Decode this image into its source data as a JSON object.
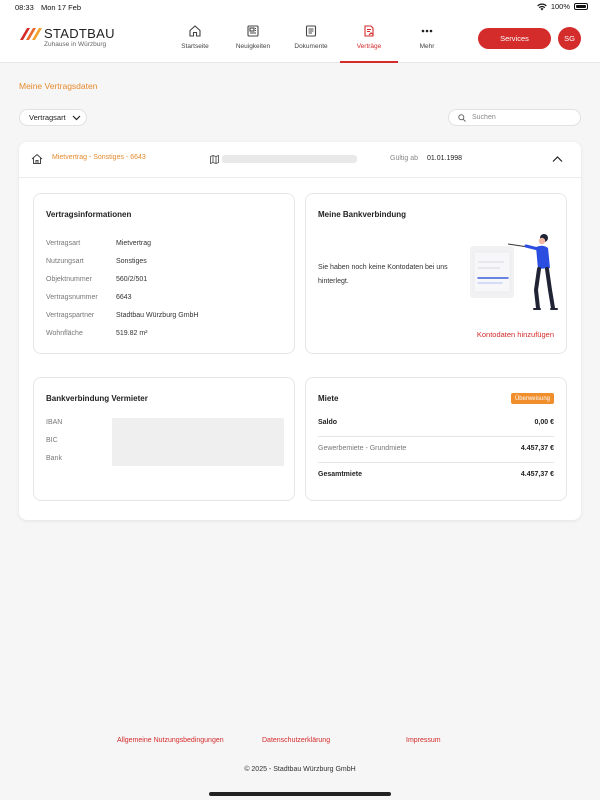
{
  "status_bar": {
    "time": "08:33",
    "date": "Mon 17 Feb",
    "battery": "100%"
  },
  "header": {
    "logo_name": "STADTBAU",
    "logo_tagline": "Zuhause in Würzburg",
    "nav": [
      {
        "label": "Startseite",
        "icon": "home-icon"
      },
      {
        "label": "Neuigkeiten",
        "icon": "news-icon"
      },
      {
        "label": "Dokumente",
        "icon": "document-icon"
      },
      {
        "label": "Verträge",
        "icon": "contract-icon",
        "active": true
      },
      {
        "label": "Mehr",
        "icon": "more-icon"
      }
    ],
    "services_label": "Services",
    "avatar_initials": "SG",
    "accent_color": "#d42b2b"
  },
  "page": {
    "title": "Meine Vertragsdaten",
    "filter_label": "Vertragsart",
    "search_placeholder": "Suchen"
  },
  "contract": {
    "title": "Mietvertrag - Sonstiges - 6643",
    "valid_label": "Gültig ab",
    "valid_date": "01.01.1998",
    "info": {
      "title": "Vertragsinformationen",
      "rows": [
        {
          "label": "Vertragsart",
          "value": "Mietvertrag"
        },
        {
          "label": "Nutzungsart",
          "value": "Sonstiges"
        },
        {
          "label": "Objektnummer",
          "value": "560/2/501"
        },
        {
          "label": "Vertragsnummer",
          "value": "6643"
        },
        {
          "label": "Vertragspartner",
          "value": "Stadtbau Würzburg GmbH"
        },
        {
          "label": "Wohnfläche",
          "value": "519.82 m²"
        }
      ]
    },
    "bank": {
      "title": "Meine Bankverbindung",
      "message": "Sie haben noch keine Kontodaten bei uns hinterlegt.",
      "add_link": "Kontodaten hinzufügen"
    },
    "landlord": {
      "title": "Bankverbindung Vermieter",
      "labels": [
        "IBAN",
        "BIC",
        "Bank"
      ]
    },
    "rent": {
      "title": "Miete",
      "badge": "Überweisung",
      "badge_color": "#ef8e2b",
      "saldo_label": "Saldo",
      "saldo_value": "0,00 €",
      "item_label": "Gewerbemiete - Grundmiete",
      "item_value": "4.457,37 €",
      "total_label": "Gesamtmiete",
      "total_value": "4.457,37 €"
    }
  },
  "footer": {
    "links": [
      "Allgemeine Nutzungsbedingungen",
      "Datenschutzerklärung",
      "Impressum"
    ],
    "copyright": "© 2025 - Stadtbau Würzburg GmbH"
  }
}
